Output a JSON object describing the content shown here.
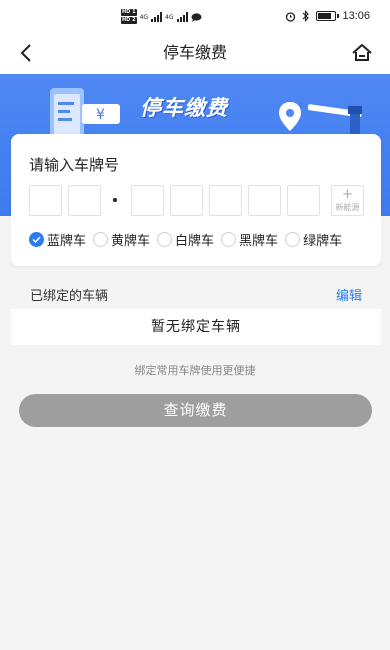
{
  "status_bar": {
    "time": "13:06",
    "sim_labels": [
      "HD 1",
      "HD 2"
    ],
    "network": [
      "4G",
      "4G"
    ]
  },
  "nav": {
    "title": "停车缴费",
    "back_icon": "back-arrow-icon",
    "home_icon": "home-icon"
  },
  "banner": {
    "title": "停车缴费",
    "currency_symbol": "¥"
  },
  "plate_card": {
    "title": "请输入车牌号",
    "new_energy_plus": "+",
    "new_energy_label": "新能源",
    "colors": [
      {
        "label": "蓝牌车",
        "checked": true
      },
      {
        "label": "黄牌车",
        "checked": false
      },
      {
        "label": "白牌车",
        "checked": false
      },
      {
        "label": "黑牌车",
        "checked": false
      },
      {
        "label": "绿牌车",
        "checked": false
      }
    ]
  },
  "bound": {
    "label": "已绑定的车辆",
    "edit": "编辑",
    "empty": "暂无绑定车辆",
    "hint": "绑定常用车牌使用更便捷"
  },
  "query_button": "查询缴费",
  "colors": {
    "accent": "#2c7bf1",
    "banner": "#4f88f3",
    "button_disabled": "#9e9e9e"
  }
}
